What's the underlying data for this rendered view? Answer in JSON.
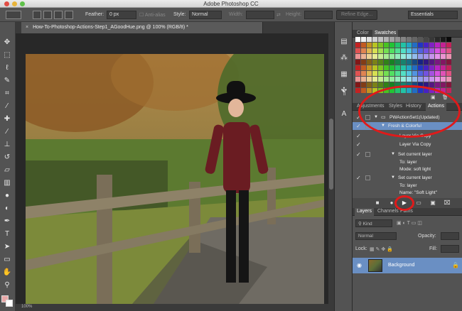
{
  "window": {
    "title": "Adobe Photoshop CC"
  },
  "options_bar": {
    "feather_label": "Feather:",
    "feather_value": "0 px",
    "antialias_label": "Anti-alias",
    "style_label": "Style:",
    "style_value": "Normal",
    "width_label": "Width:",
    "height_label": "Height:",
    "refine_edge": "Refine Edge...",
    "workspace": "Essentials"
  },
  "document": {
    "tab_title": "How-To-Photoshop-Actions-Step1_AGoodHue.png @ 100% (RGB/8) *",
    "zoom": "100%"
  },
  "status_bar": {
    "zoom": "100%"
  },
  "color_panel": {
    "tabs": [
      "Color",
      "Swatches"
    ],
    "active": "Swatches"
  },
  "actions_panel": {
    "tabs": [
      "Adjustments",
      "Styles",
      "History",
      "Actions"
    ],
    "active": "Actions",
    "items": [
      {
        "label": "PWActionSet1(Updated)"
      },
      {
        "label": "Fresh & Colorful"
      },
      {
        "label": "Layer Via Copy"
      },
      {
        "label": "Layer Via Copy"
      },
      {
        "label": "Set current layer"
      },
      {
        "label": "To: layer"
      },
      {
        "label": "Mode: soft light"
      },
      {
        "label": "Set current layer"
      },
      {
        "label": "To: layer"
      },
      {
        "label": "Name: \"Soft Light\""
      }
    ]
  },
  "layers_panel": {
    "tabs": [
      "Layers",
      "Channels",
      "Paths"
    ],
    "active": "Layers",
    "kind_label": "Kind",
    "blend_mode": "Normal",
    "opacity_label": "Opacity:",
    "lock_label": "Lock:",
    "fill_label": "Fill:",
    "layers": [
      {
        "name": "Background"
      }
    ]
  },
  "colors": {
    "highlight": "#6a8fc3",
    "annotation_red": "#e01a1a",
    "panel_bg": "#535353"
  },
  "icons": [
    "move-icon",
    "marquee-icon",
    "lasso-icon",
    "quick-select-icon",
    "crop-icon",
    "eyedropper-icon",
    "healing-icon",
    "brush-icon",
    "stamp-icon",
    "history-brush-icon",
    "eraser-icon",
    "gradient-icon",
    "blur-icon",
    "dodge-icon",
    "pen-icon",
    "type-icon",
    "path-select-icon",
    "shape-icon",
    "hand-icon",
    "zoom-icon",
    "play-icon",
    "record-icon",
    "stop-icon",
    "new-set-icon",
    "new-action-icon",
    "trash-icon",
    "eye-icon",
    "lock-icon"
  ]
}
